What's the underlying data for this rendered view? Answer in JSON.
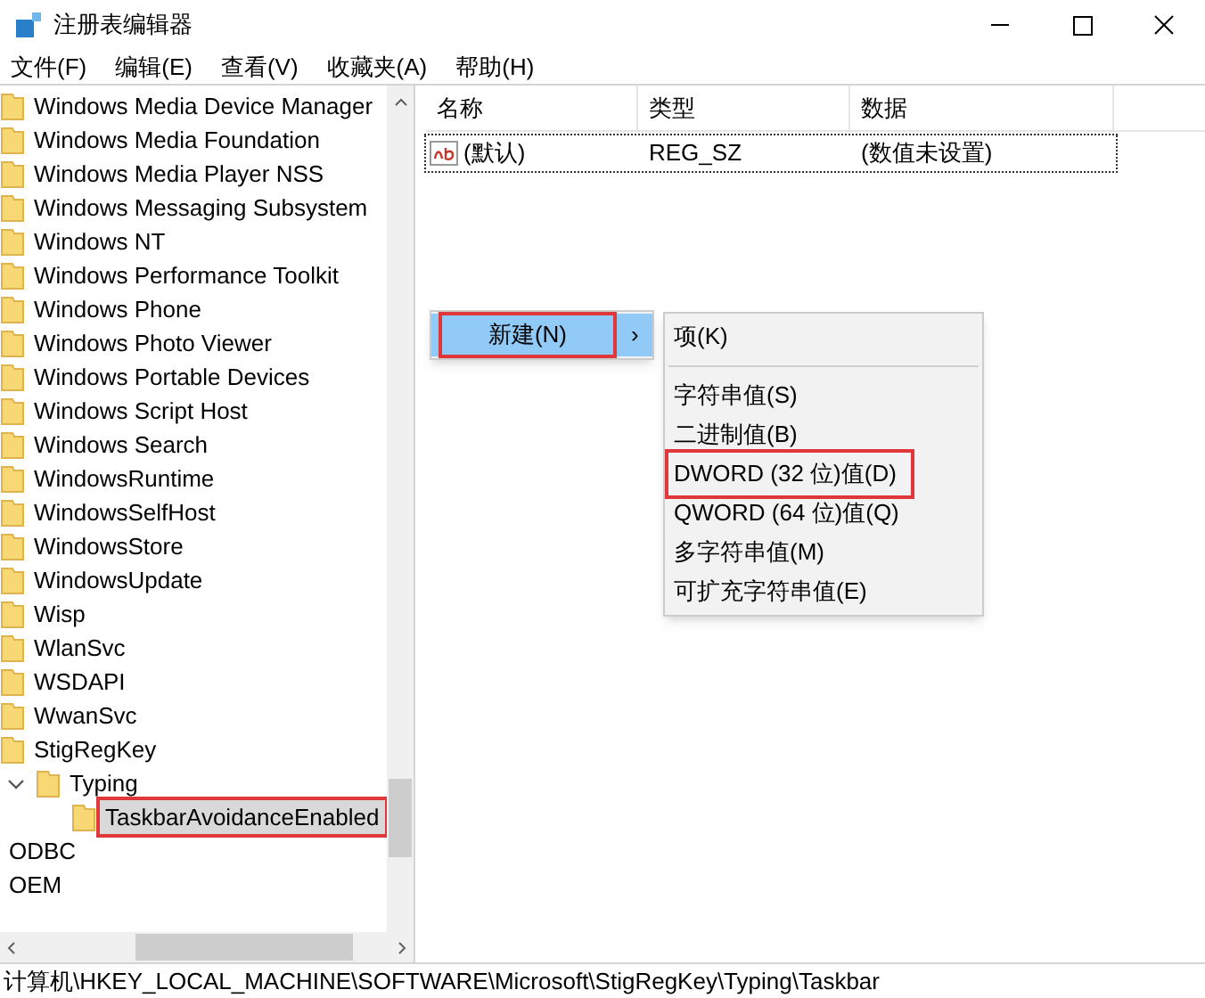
{
  "window": {
    "title": "注册表编辑器"
  },
  "menu": [
    "文件(F)",
    "编辑(E)",
    "查看(V)",
    "收藏夹(A)",
    "帮助(H)"
  ],
  "tree": [
    {
      "label": "Windows Media Device Manager",
      "kind": "folder",
      "selected": false
    },
    {
      "label": "Windows Media Foundation",
      "kind": "folder",
      "selected": false
    },
    {
      "label": "Windows Media Player NSS",
      "kind": "folder",
      "selected": false
    },
    {
      "label": "Windows Messaging Subsystem",
      "kind": "folder",
      "selected": false
    },
    {
      "label": "Windows NT",
      "kind": "folder",
      "selected": false
    },
    {
      "label": "Windows Performance Toolkit",
      "kind": "folder",
      "selected": false
    },
    {
      "label": "Windows Phone",
      "kind": "folder",
      "selected": false
    },
    {
      "label": "Windows Photo Viewer",
      "kind": "folder",
      "selected": false
    },
    {
      "label": "Windows Portable Devices",
      "kind": "folder",
      "selected": false
    },
    {
      "label": "Windows Script Host",
      "kind": "folder",
      "selected": false
    },
    {
      "label": "Windows Search",
      "kind": "folder",
      "selected": false
    },
    {
      "label": "WindowsRuntime",
      "kind": "folder",
      "selected": false
    },
    {
      "label": "WindowsSelfHost",
      "kind": "folder",
      "selected": false
    },
    {
      "label": "WindowsStore",
      "kind": "folder",
      "selected": false
    },
    {
      "label": "WindowsUpdate",
      "kind": "folder",
      "selected": false
    },
    {
      "label": "Wisp",
      "kind": "folder",
      "selected": false
    },
    {
      "label": "WlanSvc",
      "kind": "folder",
      "selected": false
    },
    {
      "label": "WSDAPI",
      "kind": "folder",
      "selected": false
    },
    {
      "label": "WwanSvc",
      "kind": "folder",
      "selected": false
    },
    {
      "label": "StigRegKey",
      "kind": "folder",
      "selected": false,
      "children": [
        {
          "label": "Typing",
          "kind": "folder",
          "selected": false,
          "expanded": true,
          "children": [
            {
              "label": "TaskbarAvoidanceEnabled",
              "kind": "folder",
              "selected": true
            }
          ]
        }
      ]
    },
    {
      "label": "ODBC",
      "kind": "plain",
      "selected": false
    },
    {
      "label": "OEM",
      "kind": "plain",
      "selected": false
    }
  ],
  "columns": [
    "名称",
    "类型",
    "数据"
  ],
  "rows": [
    {
      "name": "(默认)",
      "type": "REG_SZ",
      "data": "(数值未设置)",
      "selected": true
    }
  ],
  "context_menu": {
    "items": [
      {
        "label": "新建(N)",
        "arrow": "›",
        "selected": true
      }
    ]
  },
  "submenu": {
    "items": [
      {
        "kind": "item",
        "label": "项(K)",
        "highlighted": false
      },
      {
        "kind": "separator"
      },
      {
        "kind": "item",
        "label": "字符串值(S)",
        "highlighted": false
      },
      {
        "kind": "item",
        "label": "二进制值(B)",
        "highlighted": false
      },
      {
        "kind": "item",
        "label": "DWORD (32 位)值(D)",
        "highlighted": true
      },
      {
        "kind": "item",
        "label": "QWORD (64 位)值(Q)",
        "highlighted": false
      },
      {
        "kind": "item",
        "label": "多字符串值(M)",
        "highlighted": false
      },
      {
        "kind": "item",
        "label": "可扩充字符串值(E)",
        "highlighted": false
      }
    ]
  },
  "status_bar": "计算机\\HKEY_LOCAL_MACHINE\\SOFTWARE\\Microsoft\\StigRegKey\\Typing\\Taskbar"
}
